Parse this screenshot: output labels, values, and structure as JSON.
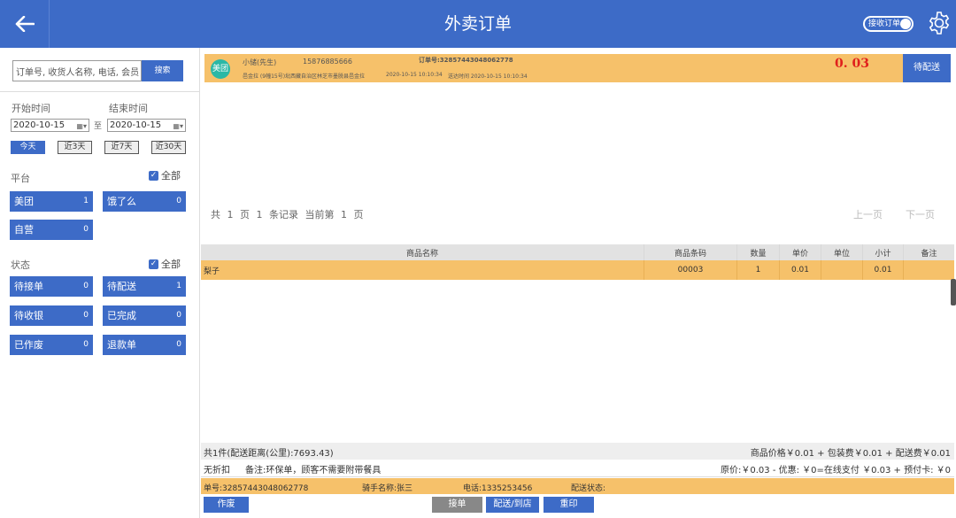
{
  "header": {
    "title": "外卖订单",
    "toggle_label": "接收订单",
    "icons": [
      "back-arrow-icon",
      "gear-icon"
    ]
  },
  "colors": {
    "primary": "#3d6bc7",
    "order_highlight": "#f6c16a",
    "amount": "#e0201c",
    "meituan": "#2bb8a6"
  },
  "sidebar": {
    "search_placeholder": "订单号, 收货人名称, 电话, 会员",
    "search_button": "搜索",
    "start_label": "开始时间",
    "end_label": "结束时间",
    "start_date": "2020-10-15",
    "end_date": "2020-10-15",
    "to": "至",
    "ranges": [
      "今天",
      "近3天",
      "近7天",
      "近30天"
    ],
    "platform_label": "平台",
    "status_label": "状态",
    "all_label": "全部",
    "platforms": [
      {
        "label": "美团",
        "count": "1"
      },
      {
        "label": "饿了么",
        "count": "0"
      },
      {
        "label": "自营",
        "count": "0"
      }
    ],
    "statuses": [
      {
        "label": "待接单",
        "count": "0"
      },
      {
        "label": "待配送",
        "count": "1"
      },
      {
        "label": "待收银",
        "count": "0"
      },
      {
        "label": "已完成",
        "count": "0"
      },
      {
        "label": "已作废",
        "count": "0"
      },
      {
        "label": "退款单",
        "count": "0"
      }
    ]
  },
  "order": {
    "badge": "美团",
    "customer": "小储(先生)",
    "phone": "15876885666",
    "order_no": "订单号:32857443048062778",
    "address": "邑金拉 (9幢15号)㘩西藏自治区林芝市墨脱县邑金拉",
    "order_time": "2020-10-15 10:10:34",
    "delivery_time": "送达时间 2020-10-15 10:10:34",
    "amount": "0. 03",
    "status": "待配送"
  },
  "pager": {
    "text": "共  1  页  1  条记录  当前第  1  页",
    "prev": "上一页",
    "next": "下一页"
  },
  "table": {
    "headers": [
      "商品名称",
      "商品条码",
      "数量",
      "单价",
      "单位",
      "小计",
      "备注"
    ],
    "rows": [
      [
        "梨子",
        "00003",
        "1",
        "0.01",
        "",
        "0.01",
        ""
      ]
    ]
  },
  "summary": {
    "count_distance": "共1件(配送距离(公里):7693.43)",
    "price_breakdown": "商品价格￥0.01 + 包装费￥0.01 + 配送费￥0.01",
    "discount": "无折扣",
    "note": "备注:环保单，顾客不需要附带餐具",
    "payment": "原价:￥0.03 - 优惠: ￥0=在线支付 ￥0.03 + 预付卡: ￥0"
  },
  "info": {
    "order_no": "单号:32857443048062778",
    "rider": "骑手名称:张三",
    "rider_phone": "电话:1335253456",
    "delivery_status": "配送状态:"
  },
  "actions": {
    "void": "作废",
    "accept": "接单",
    "deliver": "配送/到店",
    "reprint": "重印"
  }
}
